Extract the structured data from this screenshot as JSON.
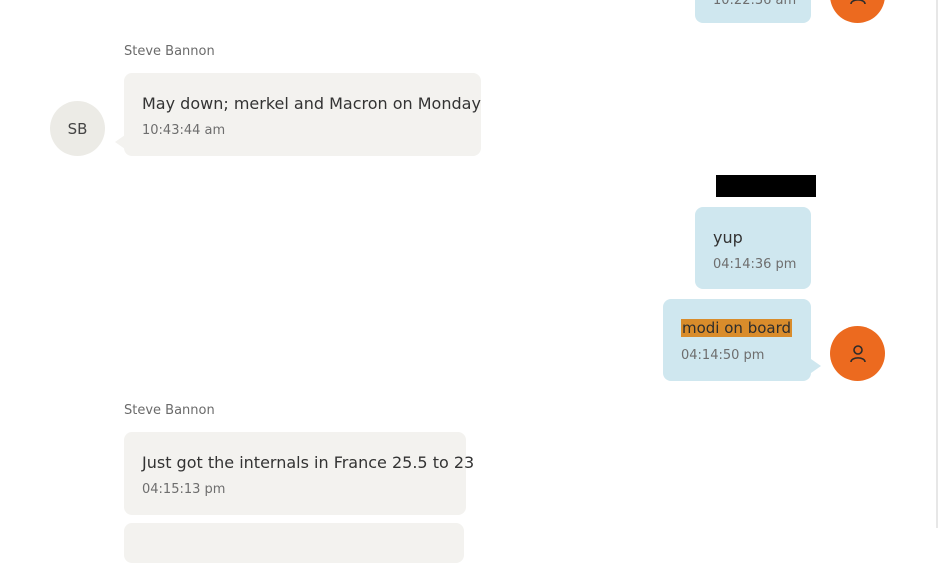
{
  "colors": {
    "incoming_bubble": "#f3f2ef",
    "outgoing_bubble": "#cfe7ef",
    "user_avatar": "#ec6a1f",
    "initials_avatar": "#ecebe6",
    "highlight": "#d98c2b"
  },
  "messages": [
    {
      "direction": "outgoing",
      "text": "",
      "time": "10:22:36 am",
      "partially_visible": true
    },
    {
      "direction": "incoming",
      "sender": "Steve Bannon",
      "avatar_initials": "SB",
      "text": "May down; merkel and Macron on Monday",
      "time": "10:43:44 am"
    },
    {
      "direction": "outgoing",
      "sender_redacted": true,
      "text": "yup",
      "time": "04:14:36 pm"
    },
    {
      "direction": "outgoing",
      "text": "modi on board",
      "highlighted": true,
      "time": "04:14:50 pm",
      "avatar_icon": "user-icon"
    },
    {
      "direction": "incoming",
      "sender": "Steve Bannon",
      "text": "Just got the internals in France 25.5 to 23",
      "time": "04:15:13 pm"
    }
  ]
}
